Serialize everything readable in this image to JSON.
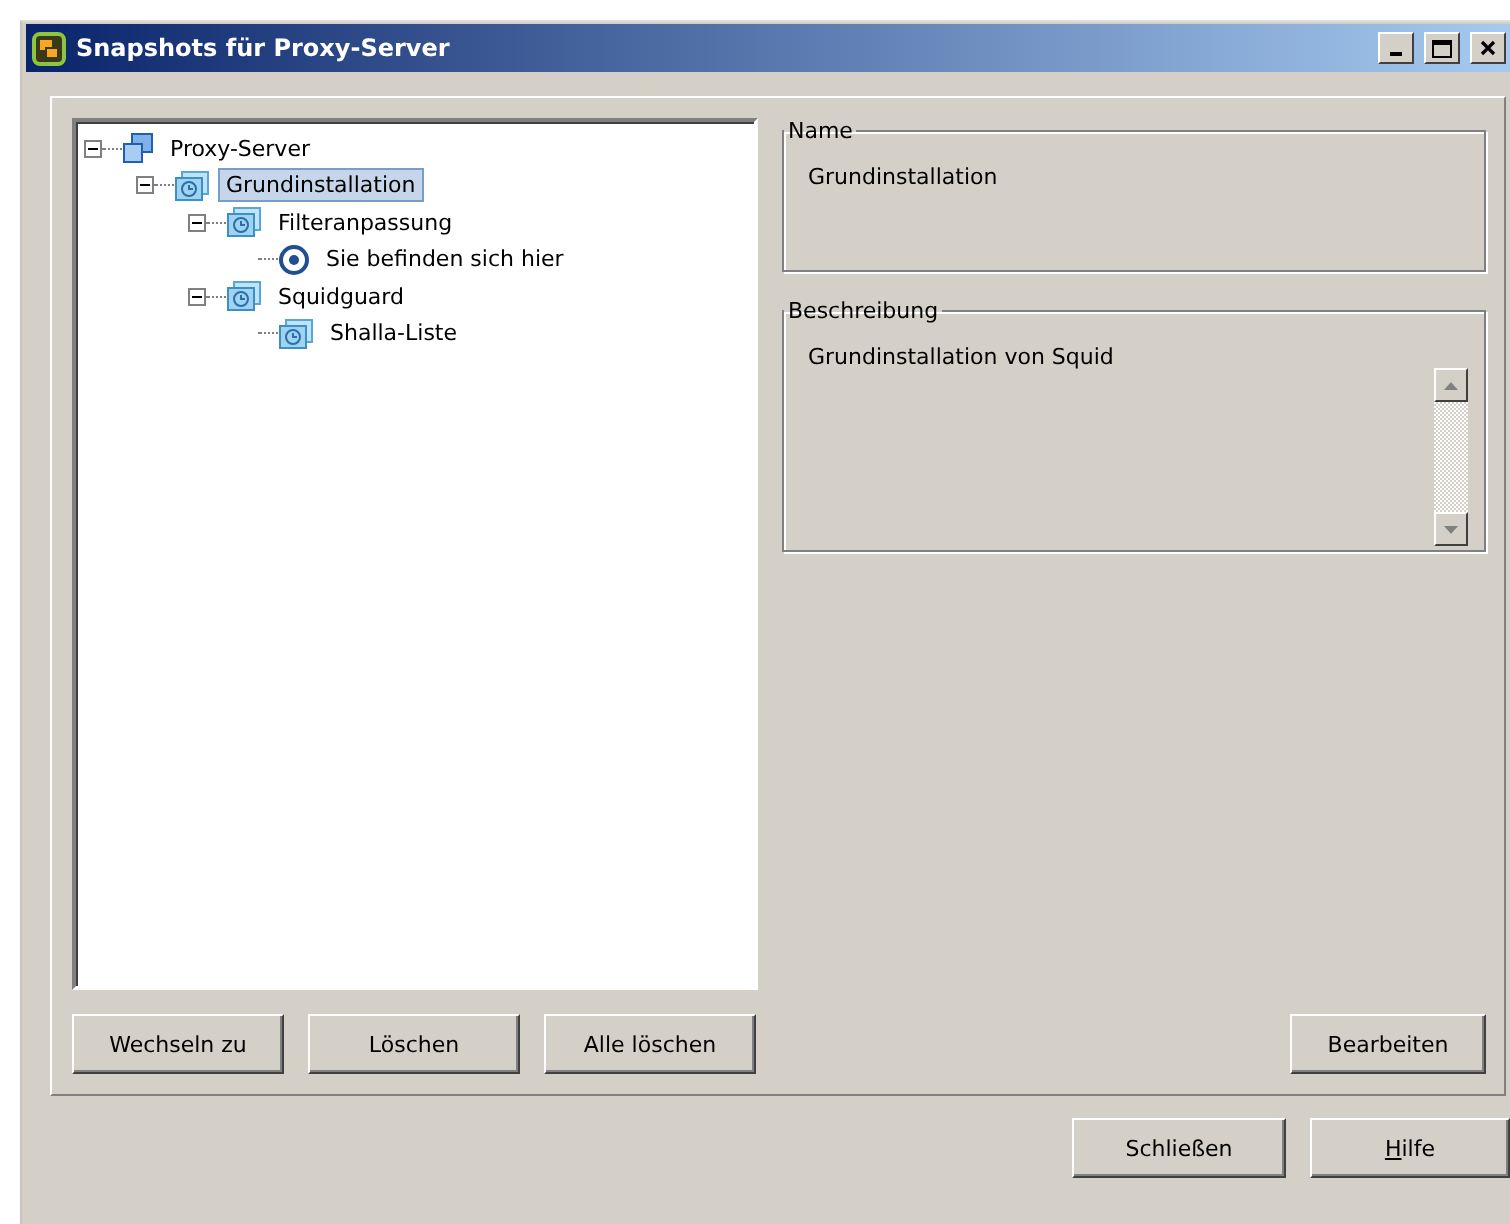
{
  "window": {
    "title": "Snapshots für Proxy-Server"
  },
  "tree": [
    {
      "label": "Proxy-Server",
      "kind": "host",
      "selected": false,
      "expanded": true,
      "children": [
        {
          "label": "Grundinstallation",
          "kind": "snapshot",
          "selected": true,
          "expanded": true,
          "children": [
            {
              "label": "Filteranpassung",
              "kind": "snapshot",
              "selected": false,
              "expanded": true,
              "children": [
                {
                  "label": "Sie befinden sich hier",
                  "kind": "current",
                  "selected": false
                }
              ]
            },
            {
              "label": "Squidguard",
              "kind": "snapshot",
              "selected": false,
              "expanded": true,
              "children": [
                {
                  "label": "Shalla-Liste",
                  "kind": "snapshot",
                  "selected": false
                }
              ]
            }
          ]
        }
      ]
    }
  ],
  "tree_buttons": [
    "Wechseln zu",
    "Löschen",
    "Alle löschen"
  ],
  "name_group": {
    "legend": "Name",
    "value": "Grundinstallation"
  },
  "description_group": {
    "legend": "Beschreibung",
    "value": "Grundinstallation von Squid"
  },
  "edit_button": "Bearbeiten",
  "dialog_buttons": [
    "Schließen",
    "Hilfe"
  ]
}
